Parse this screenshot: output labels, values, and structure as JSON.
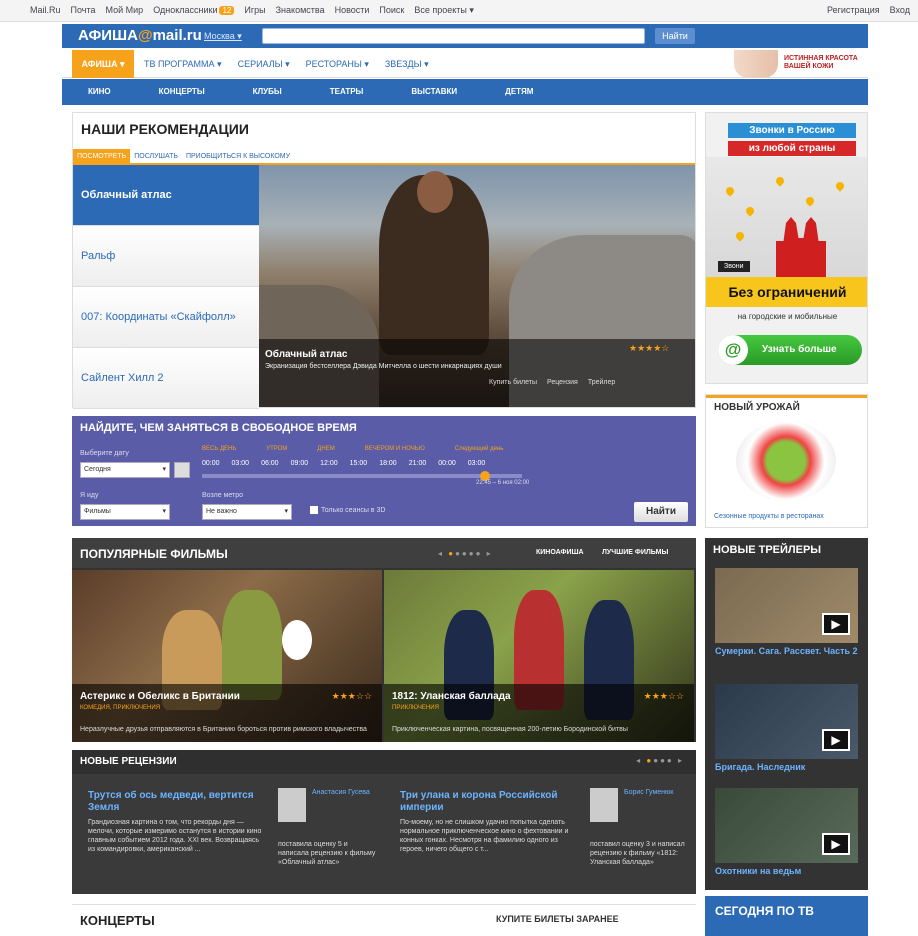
{
  "topbar": {
    "links": [
      "Mail.Ru",
      "Почта",
      "Мой Мир",
      "Одноклассники",
      "Игры",
      "Знакомства",
      "Новости",
      "Поиск",
      "Все проекты ▾"
    ],
    "badge": "12",
    "register": "Регистрация",
    "login": "Вход"
  },
  "header": {
    "logo_left": "АФИША",
    "logo_at": "@",
    "logo_right": "mail.ru",
    "city": "Москва ▾",
    "search_placeholder": "",
    "search_button": "Найти"
  },
  "nav1": {
    "active": "АФИША ▾",
    "items": [
      "ТВ ПРОГРАММА ▾",
      "СЕРИАЛЫ ▾",
      "РЕСТОРАНЫ ▾",
      "ЗВЕЗДЫ ▾"
    ],
    "ad_text": "ИСТИННАЯ КРАСОТА ВАШЕЙ КОЖИ"
  },
  "nav2": {
    "items": [
      "КИНО",
      "КОНЦЕРТЫ",
      "КЛУБЫ",
      "ТЕАТРЫ",
      "ВЫСТАВКИ",
      "ДЕТЯМ"
    ]
  },
  "recommendations": {
    "title": "НАШИ РЕКОМЕНДАЦИИ",
    "tabs": [
      "ПОСМОТРЕТЬ",
      "ПОСЛУШАТЬ",
      "ПРИОБЩИТЬСЯ К ВЫСОКОМУ"
    ],
    "items": [
      "Облачный атлас",
      "Ральф",
      "007: Координаты «Скайфолл»",
      "Сайлент Хилл 2"
    ],
    "featured_title": "Облачный атлас",
    "featured_desc": "Экранизация бестселлера Дэвида Митчелла о шести инкарнациях души",
    "stars": "★★★★☆",
    "actions": [
      "Купить билеты",
      "Рецензия",
      "Трейлер"
    ]
  },
  "ad_calls": {
    "line1": "Звонки в Россию",
    "line2": "из любой страны",
    "tag": "Звони",
    "headline": "Без ограничений",
    "sub": "на городские и мобильные",
    "button": "Узнать больше",
    "button_icon": "@"
  },
  "harvest": {
    "title": "НОВЫЙ УРОЖАЙ",
    "caption": "Сезонные продукты в ресторанах"
  },
  "find": {
    "title": "НАЙДИТЕ, ЧЕМ ЗАНЯТЬСЯ В СВОБОДНОЕ ВРЕМЯ",
    "date_label": "Выберите дату",
    "date_value": "Сегодня",
    "categories": [
      "ВЕСЬ ДЕНЬ",
      "УТРОМ",
      "ДНЕМ",
      "ВЕЧЕРОМ И НОЧЬЮ",
      "Следующий день"
    ],
    "times": [
      "00:00",
      "03:00",
      "06:00",
      "09:00",
      "12:00",
      "15:00",
      "18:00",
      "21:00",
      "00:00",
      "03:00"
    ],
    "range": "22:45 – 6 ноя 02:00",
    "what_label": "Я иду",
    "what_value": "Фильмы",
    "metro_label": "Возле метро",
    "metro_value": "Не важно",
    "checkbox": "Только сеансы в 3D",
    "button": "Найти"
  },
  "popular": {
    "title": "ПОПУЛЯРНЫЕ ФИЛЬМЫ",
    "link1": "КИНОАФИША",
    "link2": "ЛУЧШИЕ ФИЛЬМЫ",
    "films": [
      {
        "title": "Астерикс и Обеликс в Британии",
        "genre": "КОМЕДИЯ, ПРИКЛЮЧЕНИЯ",
        "desc": "Неразлучные друзья отправляются в Британию бороться против римского владычества",
        "stars": "★★★☆☆"
      },
      {
        "title": "1812: Уланская баллада",
        "genre": "ПРИКЛЮЧЕНИЯ",
        "desc": "Приключенческая картина, посвященная 200-летию Бородинской битвы",
        "stars": "★★★☆☆"
      }
    ]
  },
  "reviews": {
    "title": "НОВЫЕ РЕЦЕНЗИИ",
    "items": [
      {
        "title": "Трутся об ось медведи, вертится Земля",
        "text": "Грандиозная картина о том, что рекорды дня — мелочи, которые измеримо останутся в истории кино главным событием 2012 года. XXI век. Возвращаясь из командировки, американский ..."
      },
      {
        "title": "Три улана и корона Российской империи",
        "text": "По-моему, но не слишком удачно попытка сделать нормальное приключенческое кино о фехтовании и конных гонках. Несмотря на фамилию одного из героев, ничего общего с т..."
      }
    ],
    "authors": [
      {
        "name": "Анастасия Гусева",
        "text": "поставила оценку 5 и написала рецензию к фильму «Облачный атлас»"
      },
      {
        "name": "Борис Гуменюк",
        "text": "поставил оценку 3 и написал рецензию к фильму «1812: Уланская баллада»"
      }
    ]
  },
  "trailers": {
    "title": "НОВЫЕ ТРЕЙЛЕРЫ",
    "items": [
      "Сумерки. Сага. Рассвет. Часть 2",
      "Бригада. Наследник",
      "Охотники на ведьм"
    ]
  },
  "concerts": {
    "title": "КОНЦЕРТЫ",
    "right": "КУПИТЕ БИЛЕТЫ ЗАРАНЕЕ"
  },
  "today_tv": {
    "title": "СЕГОДНЯ ПО ТВ"
  }
}
